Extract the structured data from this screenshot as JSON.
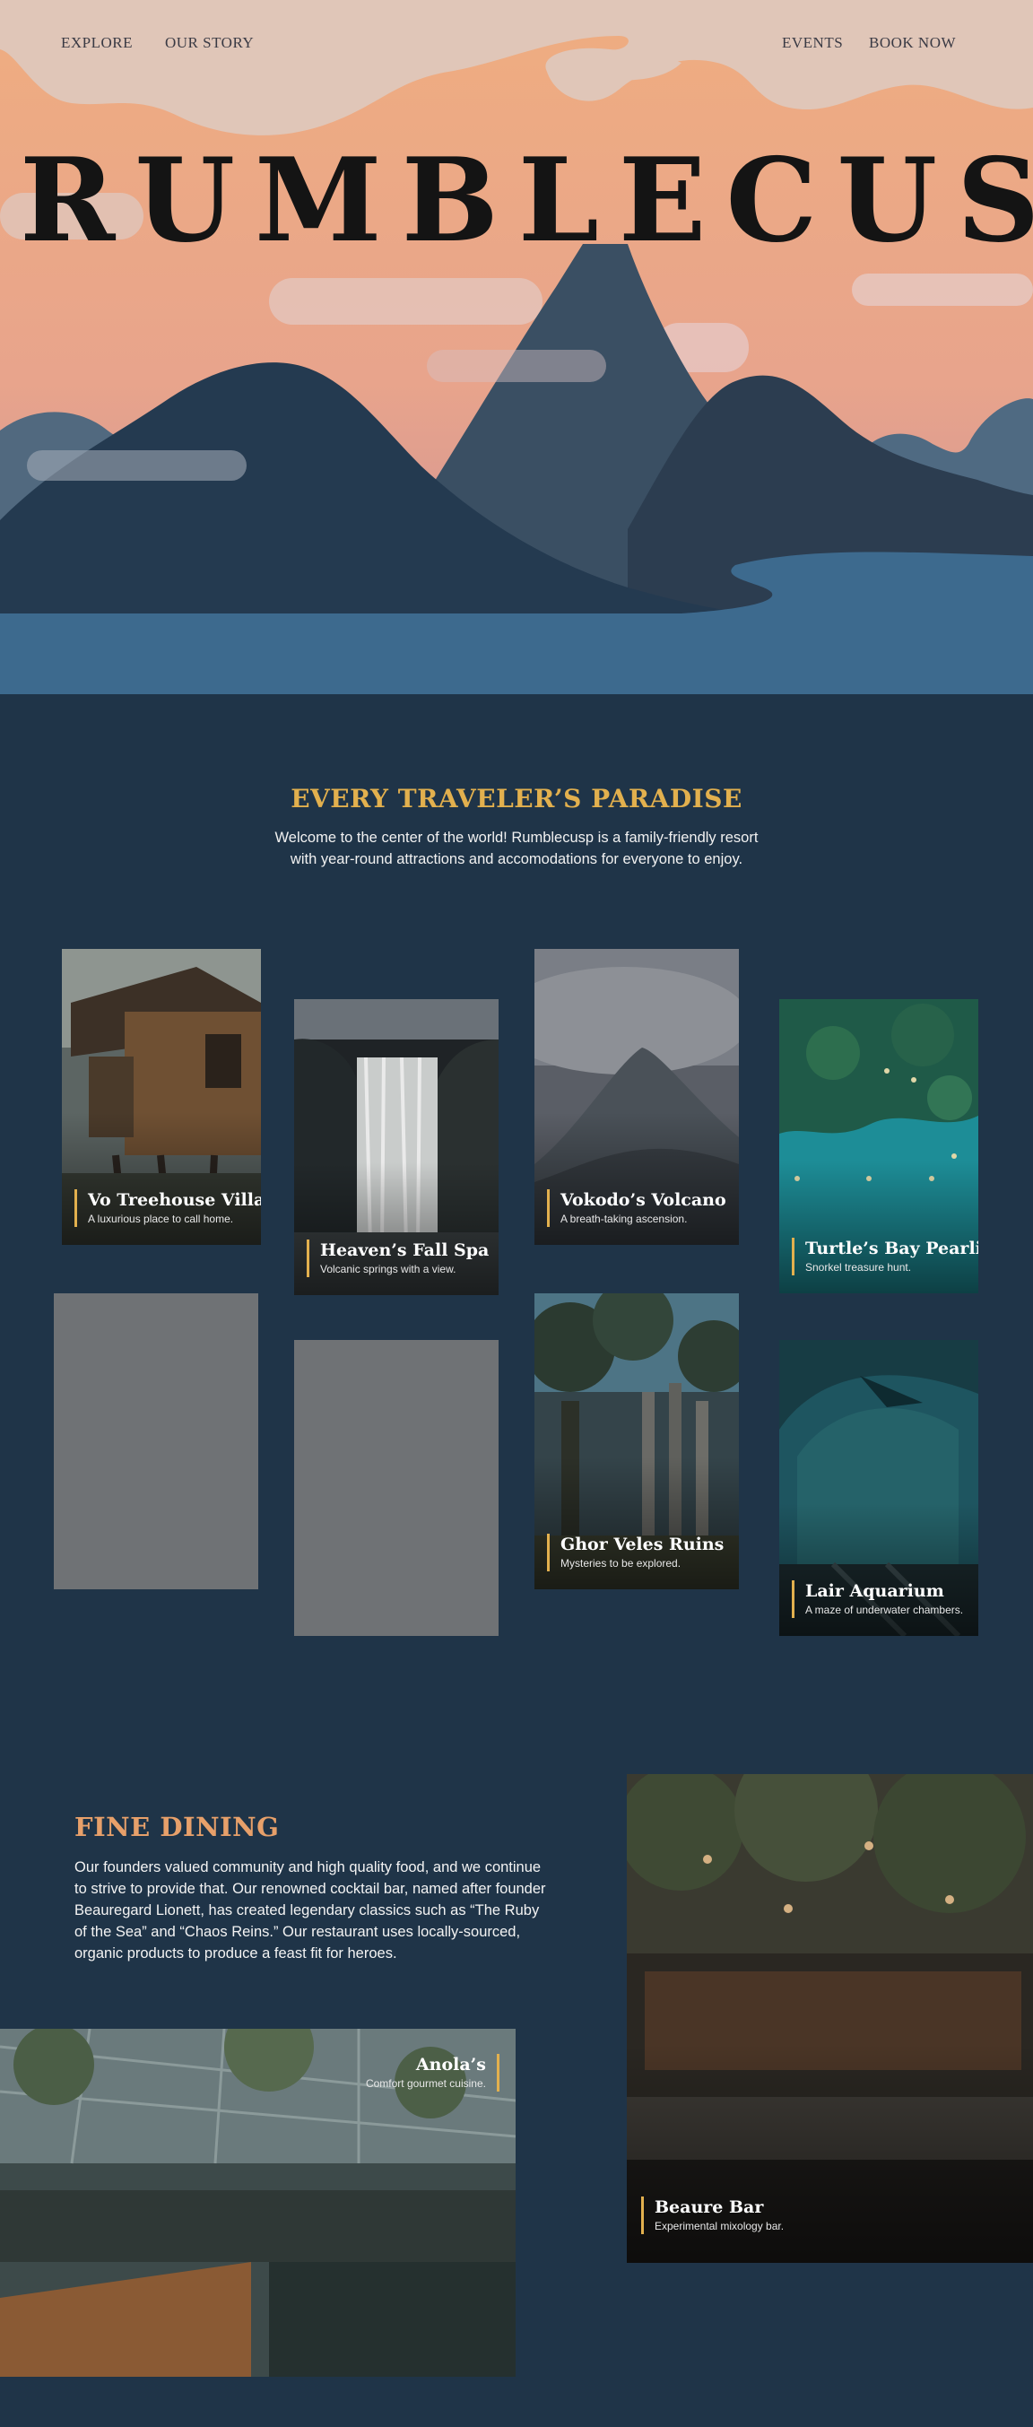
{
  "nav": {
    "explore": "EXPLORE",
    "our_story": "OUR STORY",
    "events": "EVENTS",
    "book_now": "BOOK NOW"
  },
  "hero": {
    "title": "RUMBLECUSP"
  },
  "intro": {
    "title": "EVERY TRAVELER’S PARADISE",
    "text": "Welcome to the center of the world! Rumblecusp is a family-friendly resort with year-round attractions and accomodations for everyone to enjoy."
  },
  "attractions": [
    {
      "title": "Vo Treehouse Villas",
      "subtitle": "A luxurious place to call home."
    },
    {
      "title": "Heaven’s Fall Spa",
      "subtitle": "Volcanic springs with a view."
    },
    {
      "title": "Vokodo’s Volcano",
      "subtitle": "A breath-taking ascension."
    },
    {
      "title": "Turtle’s Bay Pearling",
      "subtitle": "Snorkel treasure hunt."
    },
    {
      "title": "Ghor Veles Ruins",
      "subtitle": "Mysteries to be explored."
    },
    {
      "title": "Lair Aquarium",
      "subtitle": "A maze of underwater chambers."
    }
  ],
  "dining": {
    "title": "FINE DINING",
    "text": "Our founders valued community and high quality food, and we continue to strive to provide that. Our renowned cocktail bar, named after founder Beauregard Lionett, has created legendary classics such as “The Ruby of the Sea” and “Chaos Reins.” Our restaurant uses locally-sourced, organic products to produce a feast fit for heroes.",
    "venues": [
      {
        "title": "Beaure Bar",
        "subtitle": "Experimental mixology bar."
      },
      {
        "title": "Anola’s",
        "subtitle": "Comfort gourmet cuisine."
      }
    ]
  },
  "colors": {
    "page_background": "#1f3448",
    "accent_gold": "#e2b04e",
    "accent_peach": "#e7a06a",
    "sky_top": "#e9b98f",
    "mountain_dark": "#253a4f",
    "water": "#3d6a8e",
    "placeholder": "#6f7275"
  }
}
